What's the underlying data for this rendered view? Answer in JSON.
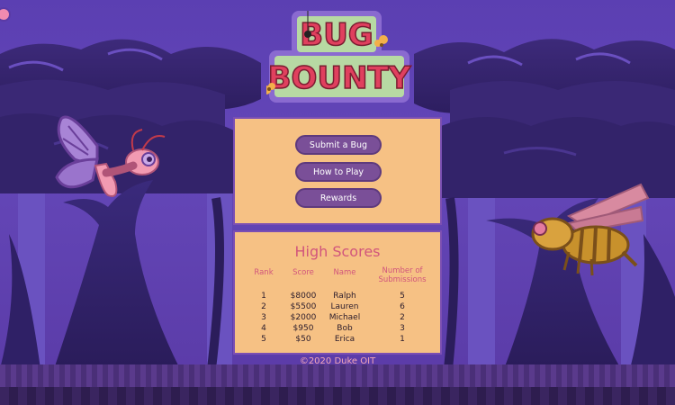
{
  "logo": {
    "line1": "BUG",
    "line2": "BOUNTY"
  },
  "menu": {
    "submit_label": "Submit a Bug",
    "how_label": "How to Play",
    "rewards_label": "Rewards"
  },
  "scores": {
    "title": "High Scores",
    "headers": {
      "rank": "Rank",
      "score": "Score",
      "name": "Name",
      "subs1": "Number of",
      "subs2": "Submissions"
    },
    "rows": [
      {
        "rank": "1",
        "score": "$8000",
        "name": "Ralph",
        "subs": "5"
      },
      {
        "rank": "2",
        "score": "$5500",
        "name": "Lauren",
        "subs": "6"
      },
      {
        "rank": "3",
        "score": "$2000",
        "name": "Michael",
        "subs": "2"
      },
      {
        "rank": "4",
        "score": "$950",
        "name": "Bob",
        "subs": "3"
      },
      {
        "rank": "5",
        "score": "$50",
        "name": "Erica",
        "subs": "1"
      }
    ]
  },
  "footer": "©2020 Duke OIT",
  "colors": {
    "panel": "#f6c184",
    "button": "#7a4f98",
    "accent": "#d1557c",
    "bg": "#5a3aa6"
  },
  "icons": [
    "sound-icon",
    "butterfly-icon",
    "bee-icon",
    "flower-icon",
    "spider-icon"
  ]
}
